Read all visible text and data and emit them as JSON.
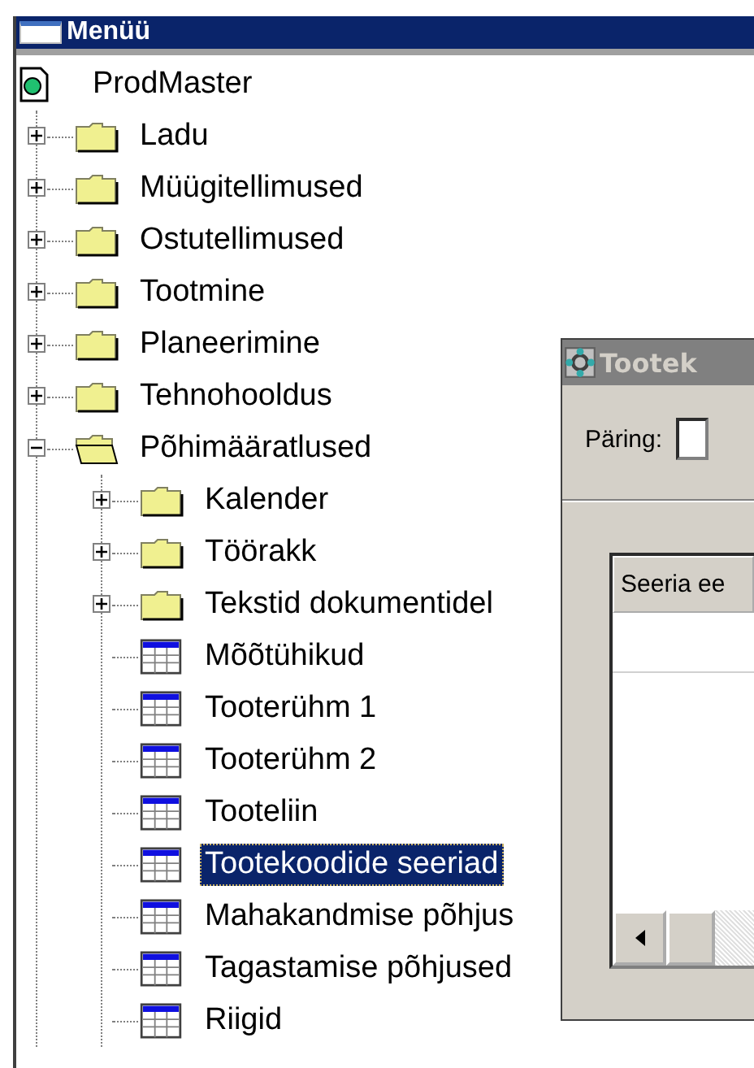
{
  "window": {
    "title": "Menüü"
  },
  "tree": {
    "label": "ProdMaster",
    "kind": "root",
    "selected": false,
    "children": [
      {
        "label": "Ladu",
        "kind": "folder",
        "expanded": false,
        "selected": false
      },
      {
        "label": "Müügitellimused",
        "kind": "folder",
        "expanded": false,
        "selected": false
      },
      {
        "label": "Ostutellimused",
        "kind": "folder",
        "expanded": false,
        "selected": false
      },
      {
        "label": "Tootmine",
        "kind": "folder",
        "expanded": false,
        "selected": false
      },
      {
        "label": "Planeerimine",
        "kind": "folder",
        "expanded": false,
        "selected": false
      },
      {
        "label": "Tehnohooldus",
        "kind": "folder",
        "expanded": false,
        "selected": false
      },
      {
        "label": "Põhimääratlused",
        "kind": "folder",
        "expanded": true,
        "selected": false,
        "children": [
          {
            "label": "Kalender",
            "kind": "folder",
            "expanded": false,
            "selected": false
          },
          {
            "label": "Töörakk",
            "kind": "folder",
            "expanded": false,
            "selected": false
          },
          {
            "label": "Tekstid dokumentidel",
            "kind": "folder",
            "expanded": false,
            "selected": false
          },
          {
            "label": "Mõõtühikud",
            "kind": "table",
            "selected": false
          },
          {
            "label": "Tooterühm 1",
            "kind": "table",
            "selected": false
          },
          {
            "label": "Tooterühm 2",
            "kind": "table",
            "selected": false
          },
          {
            "label": "Tooteliin",
            "kind": "table",
            "selected": false
          },
          {
            "label": "Tootekoodide seeriad",
            "kind": "table",
            "selected": true
          },
          {
            "label": "Mahakandmise põhjus",
            "kind": "table",
            "selected": false
          },
          {
            "label": "Tagastamise põhjused",
            "kind": "table",
            "selected": false
          },
          {
            "label": "Riigid",
            "kind": "table",
            "selected": false
          }
        ]
      }
    ]
  },
  "dialog": {
    "title": "Tootek",
    "query_label": "Päring:",
    "list": {
      "columns": [
        "Seeria ee"
      ]
    }
  }
}
